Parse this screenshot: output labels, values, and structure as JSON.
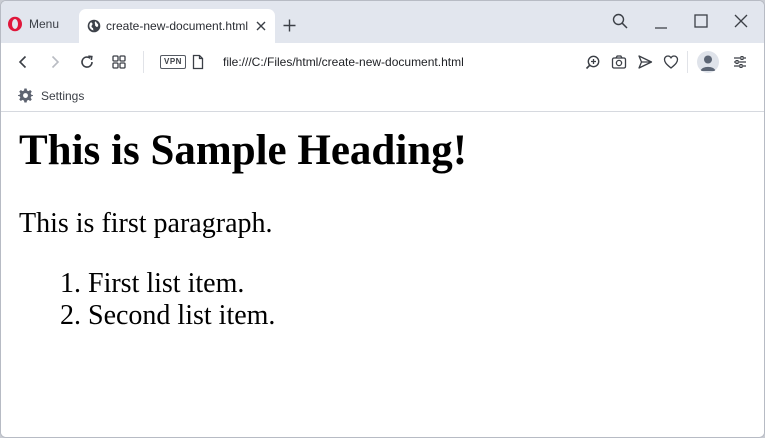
{
  "browser": {
    "menu_label": "Menu",
    "tab": {
      "title": "create-new-document.html"
    },
    "address": {
      "vpn_badge": "VPN",
      "url": "file:///C:/Files/html/create-new-document.html"
    },
    "bookmarks": [
      {
        "label": "Settings",
        "icon": "gear-icon"
      }
    ],
    "colors": {
      "tabstrip": "#e2e6ee",
      "opera_red": "#e0173b",
      "toolbar": "#ffffff"
    }
  },
  "page": {
    "heading": "This is Sample Heading!",
    "paragraph": "This is first paragraph.",
    "list": [
      {
        "marker": "1.",
        "text": "First list item."
      },
      {
        "marker": "2.",
        "text": "Second list item."
      }
    ]
  }
}
